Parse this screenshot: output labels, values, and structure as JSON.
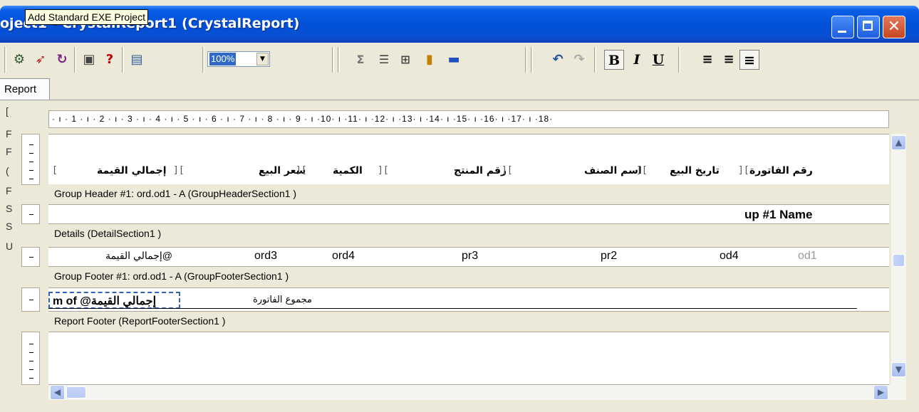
{
  "window": {
    "title": "oject1 - CrystalReport1 (CrystalReport)",
    "minimize_label": "",
    "maximize_label": "",
    "close_label": "✕"
  },
  "tooltip": "Add Standard EXE Project",
  "toolbar": {
    "zoom_value": "100%",
    "bold": "B",
    "italic": "I",
    "underline": "U",
    "help": "?",
    "sum": "Σ"
  },
  "tab": {
    "label": "Report"
  },
  "left_strip": [
    "[",
    "F",
    "F",
    "(",
    "F",
    "S",
    "S",
    "U"
  ],
  "ruler": "· ı · 1 · ı · 2 · ı · 3 · ı · 4 · ı · 5 · ı · 6 · ı · 7 · ı · 8 · ı · 9 · ı ·10· ı ·11· ı ·12· ı ·13· ı ·14· ı ·15· ı ·16· ı ·17· ı ·18·",
  "page_header": {
    "columns": [
      "رقم الفاتورة",
      "تاريخ البيع",
      "اسم الصنف",
      "رقم المنتج",
      "الكمية",
      "سعر البيع",
      "إجمالي القيمة"
    ]
  },
  "bands": {
    "group_header": "Group Header #1: ord.od1 - A (GroupHeaderSection1 )",
    "details": "Details  (DetailSection1 )",
    "group_footer": "Group Footer #1: ord.od1 - A (GroupFooterSection1 )",
    "report_footer": "Report Footer  (ReportFooterSection1 )"
  },
  "group_header_field": "up #1 Name",
  "details_fields": [
    "od1",
    "od4",
    "pr2",
    "pr3",
    "ord4",
    "ord3",
    "@إجمالي القيمة"
  ],
  "group_footer_fields": {
    "sum_label": "مجموع الفاتورة",
    "sum_field": "m of @إجمالي القيمة"
  },
  "scroll": {
    "up": "▲",
    "down": "▼",
    "left": "◀",
    "right": "▶"
  }
}
